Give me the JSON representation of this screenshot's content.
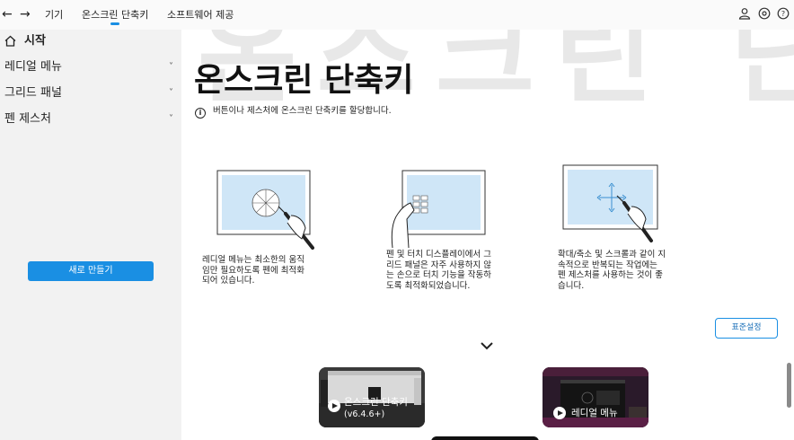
{
  "topbar": {
    "back_icon": "←",
    "forward_icon": "→",
    "tabs": [
      {
        "label": "기기"
      },
      {
        "label": "온스크린 단축키"
      },
      {
        "label": "소프트웨어 제공"
      }
    ],
    "icons": [
      "user-icon",
      "settings-icon",
      "help-icon"
    ]
  },
  "sidebar": {
    "home": {
      "label": "시작",
      "icon": "home-icon"
    },
    "items": [
      {
        "label": "레디얼 메뉴",
        "chevron": "˅"
      },
      {
        "label": "그리드 패널",
        "chevron": "˅"
      },
      {
        "label": "펜 제스처",
        "chevron": "˅"
      }
    ],
    "new_button": "새로 만들기"
  },
  "main": {
    "watermark": "온스크린 단",
    "title": "온스크린 단축키",
    "info_icon": "i",
    "info_text": "버튼이나 제스처에 온스크린 단축키를 할당합니다.",
    "features": [
      {
        "lines": [
          "레디얼 메뉴는 최소한의 움직",
          "임만 필요하도록 펜에 최적화",
          "되어 있습니다."
        ]
      },
      {
        "lines": [
          "펜 및 터치 디스플레이에서 그",
          "리드 패널은 자주 사용하지 않",
          "는 손으로 터치 기능을 작동하",
          "도록 최적화되었습니다."
        ]
      },
      {
        "lines": [
          "확대/축소 및 스크롤과 같이 지",
          "속적으로 반복되는 작업에는",
          "펜 제스처를 사용하는 것이 좋",
          "습니다."
        ]
      }
    ],
    "default_button": "표준설정",
    "videos": [
      {
        "title": "온스크린 단축키",
        "subtitle": "(v6.4.6+)"
      },
      {
        "title": "레디얼 메뉴"
      }
    ]
  },
  "colors": {
    "accent": "#1a8fe3",
    "sidebar_bg": "#f2f2f2",
    "watermark": "#e8e8e8",
    "illustration_screen": "#cfe6f7"
  }
}
